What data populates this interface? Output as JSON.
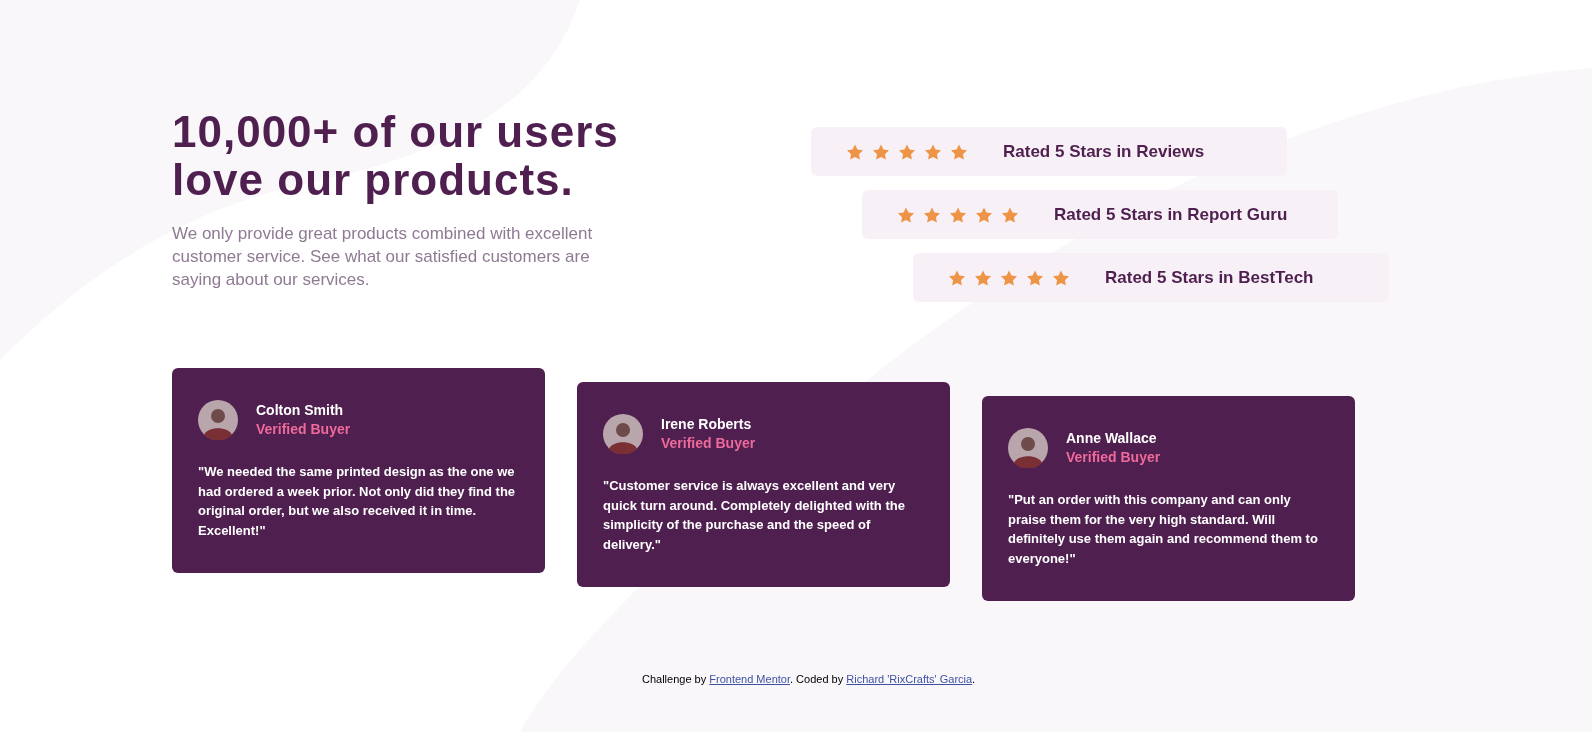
{
  "heading": "10,000+ of our users love our products.",
  "intro": "We only provide great products combined with excellent customer service. See what our satisfied customers are saying about our services.",
  "ratings": [
    {
      "stars": 5,
      "label": "Rated 5 Stars in Reviews"
    },
    {
      "stars": 5,
      "label": "Rated 5 Stars in Report Guru"
    },
    {
      "stars": 5,
      "label": "Rated 5 Stars in BestTech"
    }
  ],
  "testimonials": [
    {
      "name": "Colton Smith",
      "badge": "Verified Buyer",
      "quote": "\"We needed the same printed design as the one we had ordered a week prior. Not only did they find the original order, but we also received it in time. Excellent!\""
    },
    {
      "name": "Irene Roberts",
      "badge": "Verified Buyer",
      "quote": "\"Customer service is always excellent and very quick turn around. Completely delighted with the simplicity of the purchase and the speed of delivery.\""
    },
    {
      "name": "Anne Wallace",
      "badge": "Verified Buyer",
      "quote": "\"Put an order with this company and can only praise them for the very high standard. Will definitely use them again and recommend them to everyone!\""
    }
  ],
  "footer": [
    {
      "kind": "text",
      "text": "Challenge by "
    },
    {
      "kind": "link",
      "text": "Frontend Mentor"
    },
    {
      "kind": "text",
      "text": ". Coded by "
    },
    {
      "kind": "link",
      "text": "Richard 'RixCrafts' Garcia"
    },
    {
      "kind": "text",
      "text": "."
    }
  ]
}
